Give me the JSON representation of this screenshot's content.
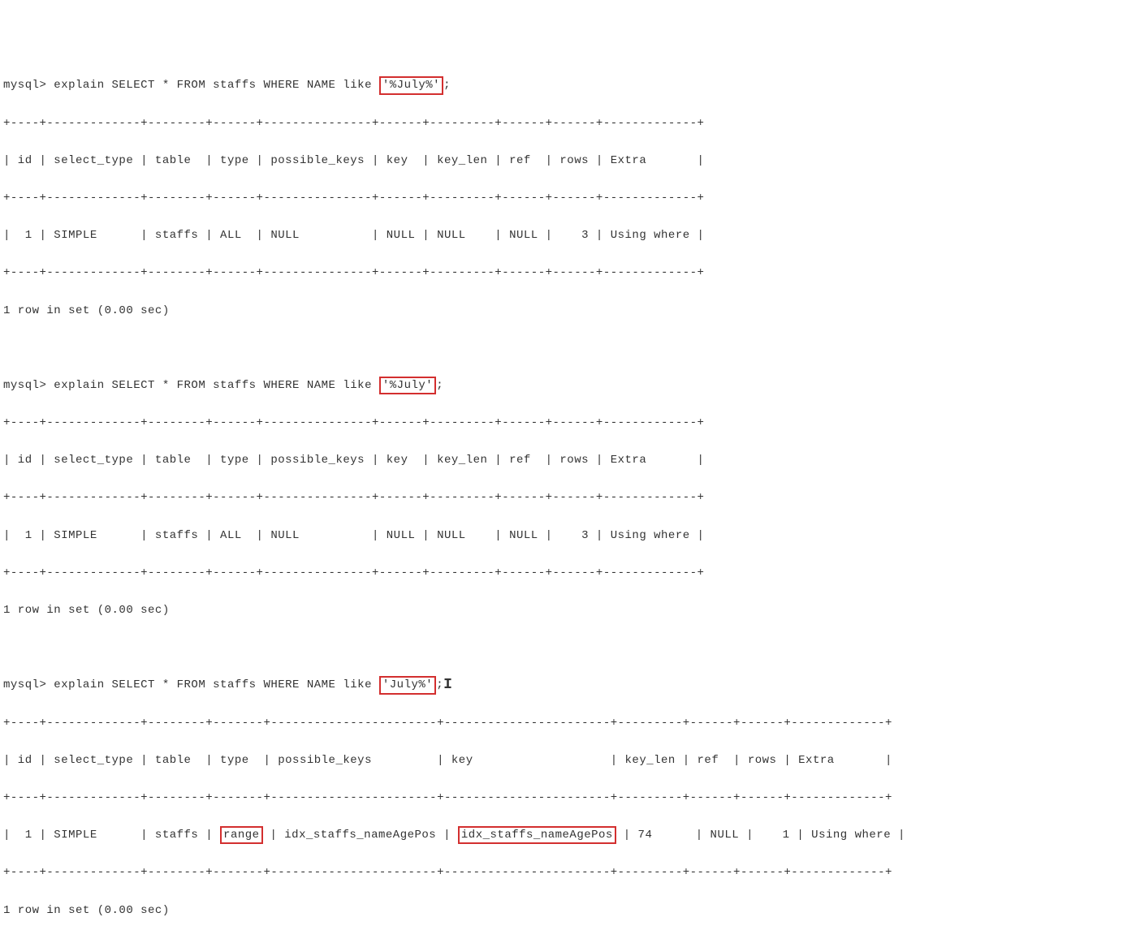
{
  "blocks": [
    {
      "prompt_prefix": "mysql> explain SELECT * FROM staffs WHERE NAME like ",
      "highlighted_literal": "'%July%'",
      "prompt_suffix": ";",
      "separator": "+----+-------------+--------+------+---------------+------+---------+------+------+-------------+",
      "header": "| id | select_type | table  | type | possible_keys | key  | key_len | ref  | rows | Extra       |",
      "row": "|  1 | SIMPLE      | staffs | ALL  | NULL          | NULL | NULL    | NULL |    3 | Using where |",
      "footer": "1 row in set (0.00 sec)"
    },
    {
      "prompt_prefix": "mysql> explain SELECT * FROM staffs WHERE NAME like ",
      "highlighted_literal": "'%July'",
      "prompt_suffix": ";",
      "separator": "+----+-------------+--------+------+---------------+------+---------+------+------+-------------+",
      "header": "| id | select_type | table  | type | possible_keys | key  | key_len | ref  | rows | Extra       |",
      "row": "|  1 | SIMPLE      | staffs | ALL  | NULL          | NULL | NULL    | NULL |    3 | Using where |",
      "footer": "1 row in set (0.00 sec)"
    },
    {
      "prompt_prefix": "mysql> explain SELECT * FROM staffs WHERE NAME like ",
      "highlighted_literal": "'July%'",
      "prompt_suffix": ";",
      "separator": "+----+-------------+--------+-------+-----------------------+-----------------------+---------+------+------+-------------+",
      "header": "| id | select_type | table  | type  | possible_keys         | key                   | key_len | ref  | rows | Extra       |",
      "row_segments": {
        "pre": "|  1 | SIMPLE      | staffs | ",
        "h1": "range",
        "mid1": " | idx_staffs_nameAgePos | ",
        "h2": "idx_staffs_nameAgePos",
        "post": " | 74      | NULL |    1 | Using where |"
      },
      "footer": "1 row in set (0.00 sec)",
      "show_cursor": true
    }
  ]
}
